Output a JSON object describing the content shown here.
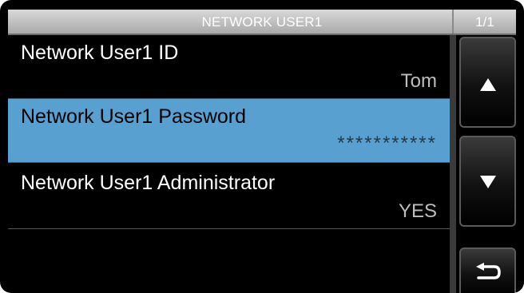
{
  "header": {
    "title": "NETWORK USER1",
    "page_indicator": "1/1"
  },
  "items": [
    {
      "label": "Network User1 ID",
      "value": "Tom",
      "selected": false
    },
    {
      "label": "Network User1 Password",
      "value": "***********",
      "selected": true
    },
    {
      "label": "Network User1 Administrator",
      "value": "YES",
      "selected": false
    }
  ],
  "sidebar": {
    "buttons": [
      {
        "icon": "triangle-up-icon"
      },
      {
        "icon": "triangle-down-icon"
      },
      {
        "icon": "return-arrow-icon"
      }
    ]
  },
  "colors": {
    "selected_row": "#58a0cf",
    "title_bar": "#bdbdbd",
    "background": "#000000"
  }
}
